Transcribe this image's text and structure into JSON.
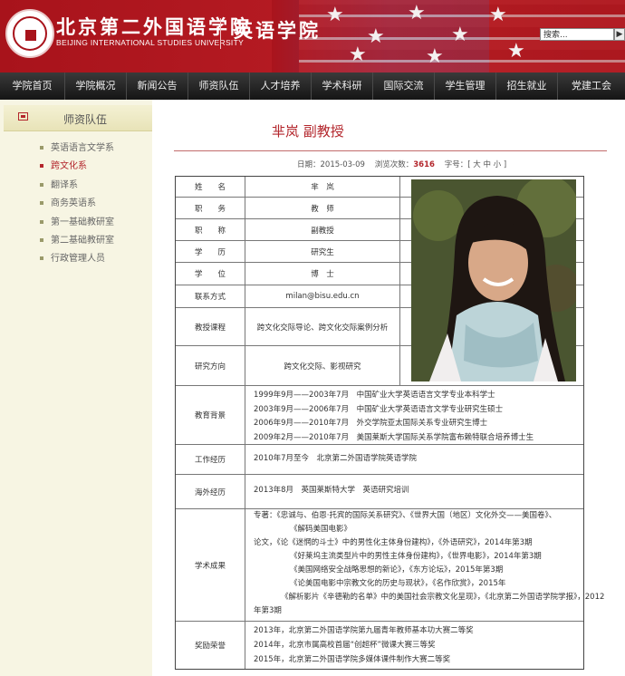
{
  "header": {
    "school_name_cn": "北京第二外国语学院",
    "school_name_en": "BEIJING INTERNATIONAL STUDIES UNIVERSITY",
    "college_name": "英语学院",
    "search_placeholder": "搜索...",
    "search_button": "▶"
  },
  "nav": {
    "items": [
      "学院首页",
      "学院概况",
      "新闻公告",
      "师资队伍",
      "人才培养",
      "学术科研",
      "国际交流",
      "学生管理",
      "招生就业",
      "党建工会"
    ]
  },
  "sidebar": {
    "title": "师资队伍",
    "items": [
      "英语语言文学系",
      "跨文化系",
      "翻译系",
      "商务英语系",
      "第一基础教研室",
      "第二基础教研室",
      "行政管理人员"
    ],
    "active_index": 1
  },
  "article": {
    "title": "芈岚 副教授",
    "date_label": "日期：",
    "date": "2015-03-09",
    "views_label": "浏览次数：",
    "views": "3616",
    "font_label": "字号：[ 大 中 小 ]"
  },
  "profile": {
    "name_label": "姓　　名",
    "name": "芈　岚",
    "post_label": "职　　务",
    "post": "教　师",
    "title_label": "职　　称",
    "title": "副教授",
    "edu_label": "学　　历",
    "edu": "研究生",
    "degree_label": "学　　位",
    "degree": "博　士",
    "contact_label": "联系方式",
    "contact": "milan@bisu.edu.cn",
    "courses_label": "教授课程",
    "courses": "跨文化交际导论、跨文化交际案例分析",
    "research_label": "研究方向",
    "research": "跨文化交际、影视研究",
    "education_label": "教育背景",
    "education": [
      "1999年9月——2003年7月　中国矿业大学英语语言文学专业本科学士",
      "2003年9月——2006年7月　中国矿业大学英语语言文学专业研究生硕士",
      "2006年9月——2010年7月　外交学院亚太国际关系专业研究生博士",
      "2009年2月——2010年7月　美国莱斯大学国际关系学院富布赖特联合培养博士生"
    ],
    "work_label": "工作经历",
    "work": "2010年7月至今　北京第二外国语学院英语学院",
    "overseas_label": "海外经历",
    "overseas": "2013年8月　英国莱斯特大学　英语研究培训",
    "academic_label": "学术成果",
    "academic": [
      "专著：《忠诚与、伯恩·托宾的国际关系研究》、《世界大国（地区）文化外交——美国卷》、",
      "《解码美国电影》",
      "论文，《论《迷惘的斗士》中的男性化主体身份建构》，《外语研究》，2014年第3期",
      "《好莱坞主流类型片中的男性主体身份建构》，《世界电影》，2014年第3期",
      "《美国网络安全战略思想的新论》，《东方论坛》，2015年第3期",
      "《论美国电影中宗教文化的历史与现状》，《名作欣赏》，2015年",
      "《解析影片《辛德勒的名单》中的美国社会宗教文化呈现》，《北京第二外国语学院学报》，2012",
      "年第3期"
    ],
    "awards_label": "奖励荣誉",
    "awards": [
      "2013年，北京第二外国语学院第九届青年教师基本功大赛二等奖",
      "2014年，北京市属高校首届“创超杯”微课大赛三等奖",
      "2015年，北京第二外国语学院多媒体课件制作大赛二等奖"
    ]
  }
}
